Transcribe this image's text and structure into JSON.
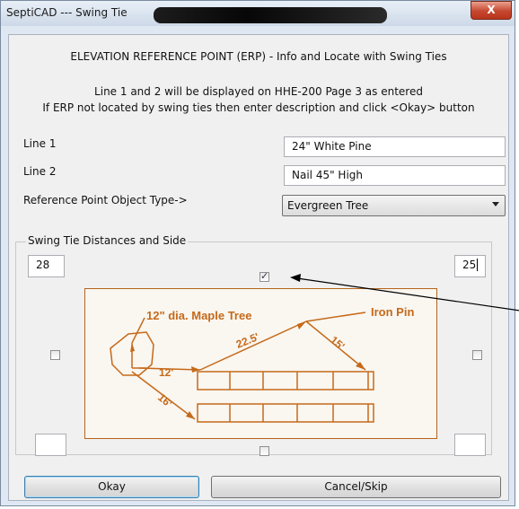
{
  "window": {
    "title": "SeptiCAD --- Swing Tie",
    "close_label": "X"
  },
  "header": {
    "heading": "ELEVATION REFERENCE POINT (ERP) - Info and Locate with Swing Ties",
    "info_line1": "Line 1 and 2 will be displayed on HHE-200 Page 3 as entered",
    "info_line2": "If ERP not located by swing ties then enter description and click <Okay> button"
  },
  "fields": {
    "line1_label": "Line 1",
    "line1_value": "24\" White Pine",
    "line2_label": "Line 2",
    "line2_value": "Nail 45\" High",
    "object_type_label": "Reference Point Object Type->",
    "object_type_value": "Evergreen Tree"
  },
  "swing_ties": {
    "group_label": "Swing Tie Distances and Side",
    "left_distance": "28",
    "right_distance": "25",
    "top_checked": true,
    "left_checked": false,
    "right_checked": false,
    "bottom_checked": false,
    "bottom_left_value": "",
    "bottom_right_value": ""
  },
  "diagram": {
    "tree_label": "12\" dia. Maple Tree",
    "pin_label": "Iron Pin",
    "dist_tree_house": "12'",
    "dist_tree_house2": "16'",
    "dist_house_pin": "22.5'",
    "dist_pin_house": "15'",
    "color": "#c56a1a"
  },
  "buttons": {
    "okay": "Okay",
    "cancel": "Cancel/Skip"
  }
}
